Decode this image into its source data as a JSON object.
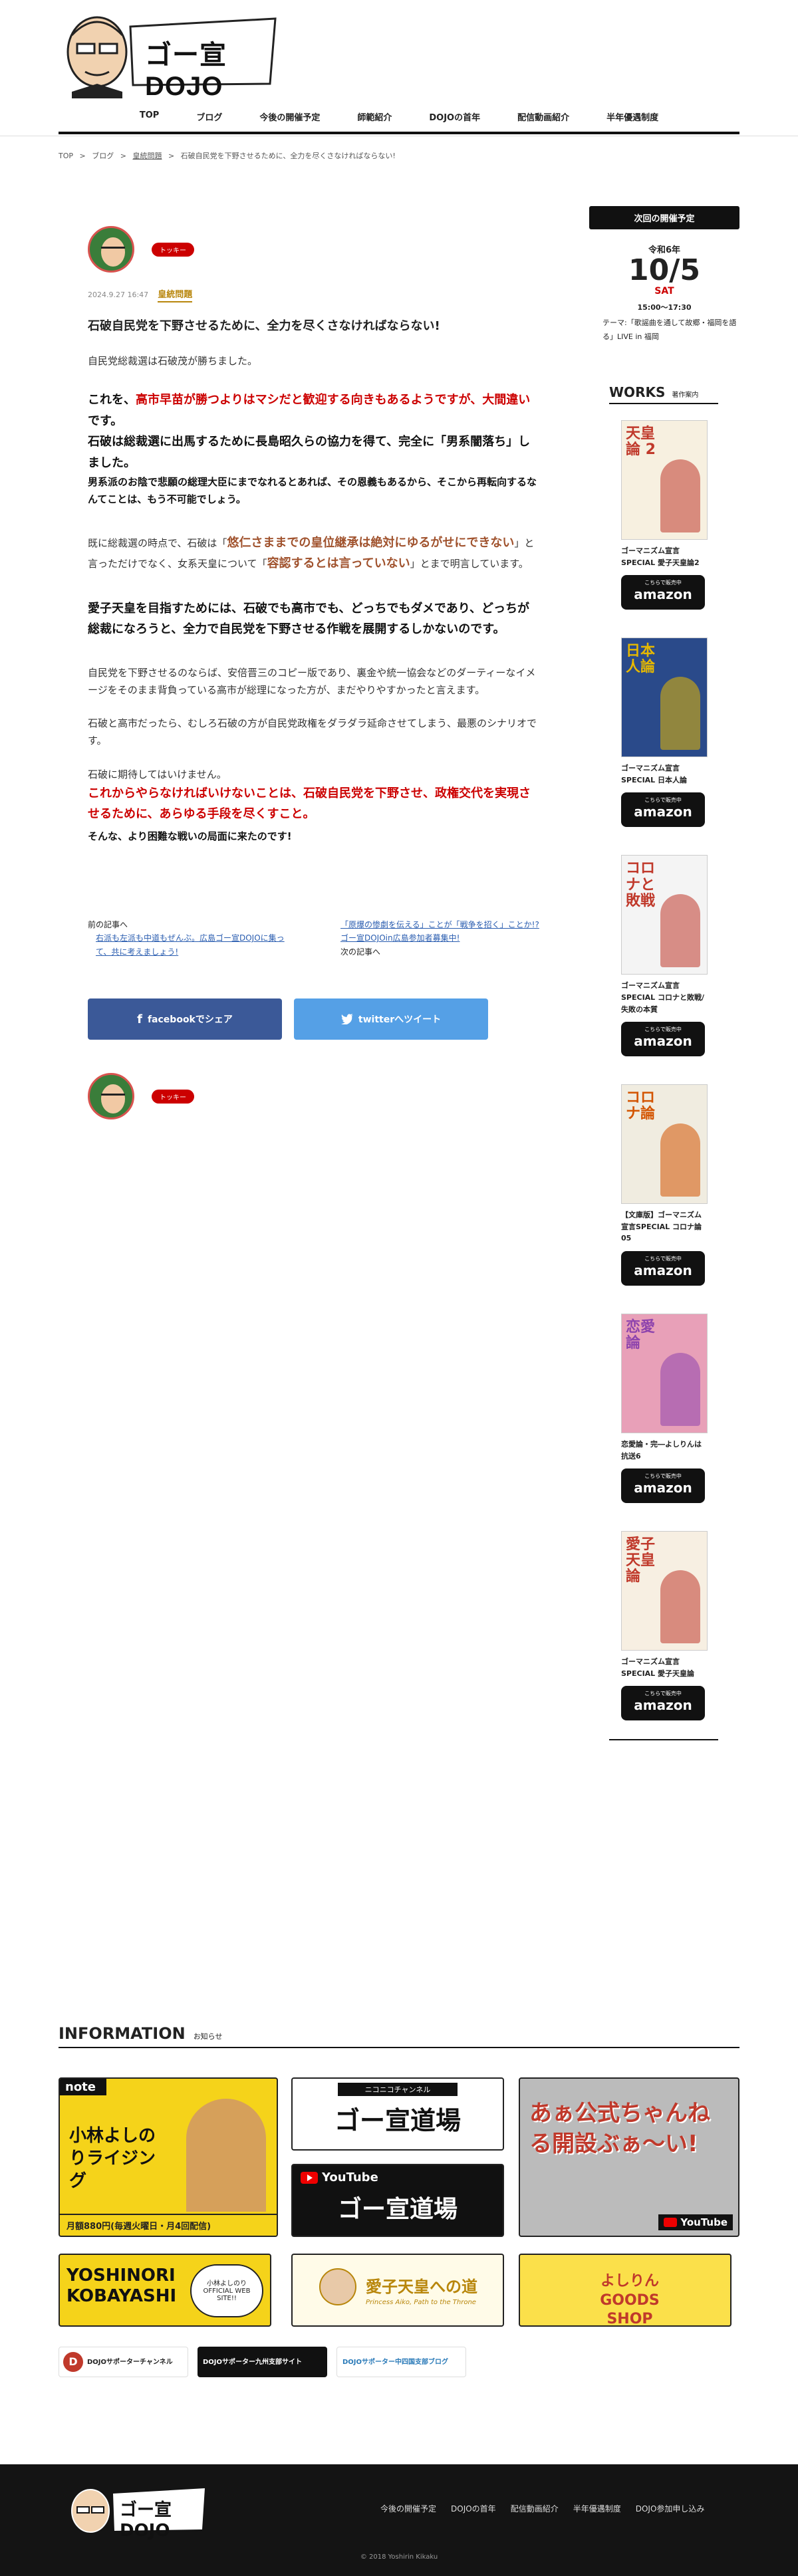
{
  "header": {
    "logo_text": "ゴー宣DOJO",
    "nav": [
      "TOP",
      "ブログ",
      "今後の開催予定",
      "師範紹介",
      "DOJOの首年",
      "配信動画紹介",
      "半年優遇制度"
    ]
  },
  "breadcrumb": [
    "TOP",
    ">",
    "ブログ",
    ">",
    "皇統問題",
    ">",
    "石破自民党を下野させるために、全力を尽くさなければならない!"
  ],
  "article": {
    "author_tag": "トッキー",
    "date": "2024.9.27 16:47",
    "category": "皇統問題",
    "title": "石破自民党を下野させるために、全力を尽くさなければならない!",
    "p1": "自民党総裁選は石破茂が勝ちました。",
    "p2a": "これを、",
    "p2b": "高市早苗が勝つよりはマシだと歓迎する向きもあるようですが、大間違い",
    "p2c": "です。",
    "p3": "石破は総裁選に出馬するために長島昭久らの協力を得て、完全に「男系闇落ち」しました。",
    "p4": "男系派のお陰で悲願の総理大臣にまでなれるとあれば、その恩義もあるから、そこから再転向するなんてことは、もう不可能でしょう。",
    "p5a": "既に総裁選の時点で、石破は「",
    "p5b": "悠仁さままでの皇位継承は絶対にゆるがせにできない",
    "p5c": "」と言っただけでなく、女系天皇について「",
    "p5d": "容認するとは言っていない",
    "p5e": "」とまで明言しています。",
    "p6": "愛子天皇を目指すためには、石破でも高市でも、どっちでもダメであり、どっちが総裁になろうと、全力で自民党を下野させる作戦を展開するしかないのです。",
    "p7": "自民党を下野させるのならば、安倍晋三のコピー版であり、裏金や統一協会などのダーティーなイメージをそのまま背負っている高市が総理になった方が、まだやりやすかったと言えます。",
    "p8": "石破と高市だったら、むしろ石破の方が自民党政権をダラダラ延命させてしまう、最悪のシナリオです。",
    "p9": "石破に期待してはいけません。",
    "p10": "これからやらなければいけないことは、石破自民党を下野させ、政権交代を実現させるために、あらゆる手段を尽くすこと。",
    "p11": "そんな、より困難な戦いの局面に来たのです!",
    "prev_label": "前の記事へ",
    "prev_link": "右派も左派も中道もぜんぶ。広島ゴー宣DOJOに集って、共に考えましょう!",
    "next_link": "「原爆の惨劇を伝える」ことが「戦争を招く」ことか!? ゴー宣DOJOin広島参加者募集中!",
    "next_label": "次の記事へ",
    "fb_label": "facebookでシェア",
    "tw_label": "twitterへツイート",
    "author_tag2": "トッキー"
  },
  "sidebar": {
    "event_header": "次回の開催予定",
    "event_year": "令和6年",
    "event_day": "10/5",
    "event_dow": "SAT",
    "event_time": "15:00〜17:30",
    "event_theme": "テーマ:「歌謡曲を通して故郷・福岡を語る」LIVE in 福岡",
    "works_title": "WORKS",
    "works_sub": "著作案内",
    "amazon_small": "こちらで販売中",
    "amazon_big": "amazon",
    "works": [
      {
        "title": "ゴーマニズム宣言SPECIAL 愛子天皇論2",
        "cover_text": "天皇論 2",
        "c1": "#f7f0e0",
        "c2": "#c0392b"
      },
      {
        "title": "ゴーマニズム宣言SPECIAL 日本人論",
        "cover_text": "日本人論",
        "c1": "#2a4a8a",
        "c2": "#e6b800"
      },
      {
        "title": "ゴーマニズム宣言SPECIAL コロナと敗戦/失敗の本質",
        "cover_text": "コロナと敗戦",
        "c1": "#f4f4f4",
        "c2": "#c0392b"
      },
      {
        "title": "【文庫版】ゴーマニズム宣言SPECIAL コロナ論05",
        "cover_text": "コロナ論",
        "c1": "#f0ece0",
        "c2": "#d35400"
      },
      {
        "title": "恋愛論・完―よしりんは抗送6",
        "cover_text": "恋愛論",
        "c1": "#e8a0b8",
        "c2": "#8e44ad"
      },
      {
        "title": "ゴーマニズム宣言SPECIAL 愛子天皇論",
        "cover_text": "愛子天皇論",
        "c1": "#f7efe2",
        "c2": "#c0392b"
      }
    ]
  },
  "info": {
    "title": "INFORMATION",
    "sub": "お知らせ",
    "note_brand": "note",
    "note_main": "小林よしのりライジング",
    "note_price": "月額880円(毎週火曜日・月4回配信)",
    "nico_top": "ニコニコチャンネル",
    "nico_main": "ゴー宣道場",
    "yt_top": "YouTube",
    "yt_main": "ゴー宣道場",
    "ch_main": "あぁ公式ちゃんねる開設ぶぁ〜い!",
    "ch_yt": "YouTube",
    "yk_main": "YOSHINORI KOBAYASHI",
    "yk_sub": "小林よしのり OFFICIAL WEB SITE!!",
    "aiko_main": "愛子天皇への道",
    "aiko_sub": "Princess Aiko, Path to the Throne",
    "goods_main": "よしりん GOODS SHOP",
    "s1": "DOJOサポーターチャンネル",
    "s2": "DOJOサポーター九州支部サイト",
    "s3": "DOJOサポーター中四国支部ブログ"
  },
  "footer": {
    "logo_text": "ゴー宣DOJO",
    "nav": [
      "今後の開催予定",
      "DOJOの首年",
      "配信動画紹介",
      "半年優遇制度",
      "DOJO参加申し込み"
    ],
    "copyright": "© 2018 Yoshirin Kikaku"
  }
}
